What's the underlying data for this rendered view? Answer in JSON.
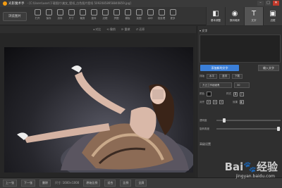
{
  "window": {
    "title": "光影魔术手",
    "path": "- [C:\\Users\\user\\下载图片\\美女_壁纸_白色图片壁纸 50920858958840859.jpg]",
    "minimize": "–",
    "maximize": "□",
    "close": "✕"
  },
  "toolbar": {
    "open_label": "浏览图片",
    "tools": [
      {
        "label": "打开",
        "icon": "folder-icon"
      },
      {
        "label": "保存",
        "icon": "save-icon"
      },
      {
        "label": "另存",
        "icon": "save-as-icon"
      },
      {
        "label": "尺寸",
        "icon": "resize-icon"
      },
      {
        "label": "裁剪",
        "icon": "crop-icon"
      },
      {
        "label": "旋转",
        "icon": "rotate-icon"
      },
      {
        "label": "边框",
        "icon": "border-icon"
      },
      {
        "label": "拼图",
        "icon": "collage-icon"
      },
      {
        "label": "模板",
        "icon": "template-icon"
      },
      {
        "label": "抠图",
        "icon": "cutout-icon"
      },
      {
        "label": "水印",
        "icon": "watermark-icon"
      },
      {
        "label": "批处理",
        "icon": "batch-icon"
      },
      {
        "label": "更多",
        "icon": "more-icon"
      }
    ]
  },
  "modes": [
    {
      "label": "基本调整",
      "icon": "adjust-icon",
      "glyph": "◧"
    },
    {
      "label": "数码暗房",
      "icon": "darkroom-icon",
      "glyph": "◉"
    },
    {
      "label": "文字",
      "icon": "text-icon",
      "glyph": "T"
    },
    {
      "label": "边框",
      "icon": "frame-icon",
      "glyph": "▣"
    }
  ],
  "subbar": {
    "items": [
      "◂ 对比",
      "⟲ 撤销",
      "⟳ 重做",
      "↺ 还原"
    ]
  },
  "panel": {
    "title": "▾ 文字",
    "add_text": "添加新的文字",
    "input_btn": "输入文字",
    "style_label": "排版",
    "style_options": [
      "水平",
      "竖排",
      "下载"
    ],
    "font_value": "方正兰亭超细黑",
    "size_value": "30",
    "color_label": "颜色",
    "style2_label": "样式",
    "bold": "B",
    "italic": "I",
    "align_label": "对齐",
    "effect_label": "效果",
    "opacity_label": "透明度",
    "opacity_value": 0.1,
    "rotation_label": "旋转角度",
    "rotation_value": 0.94,
    "advanced_label": "高级设置"
  },
  "statusbar": {
    "prev": "上一张",
    "next": "下一张",
    "delete": "删除",
    "size_info": "尺寸: 1600×1000",
    "actual": "原始比例",
    "fit": "适合",
    "ratio": "比例",
    "fullscreen": "全屏"
  },
  "watermark": {
    "brand": "Bai",
    "paw": "🐾",
    "suffix": "经验",
    "site": "jingyan.baidu.com"
  }
}
